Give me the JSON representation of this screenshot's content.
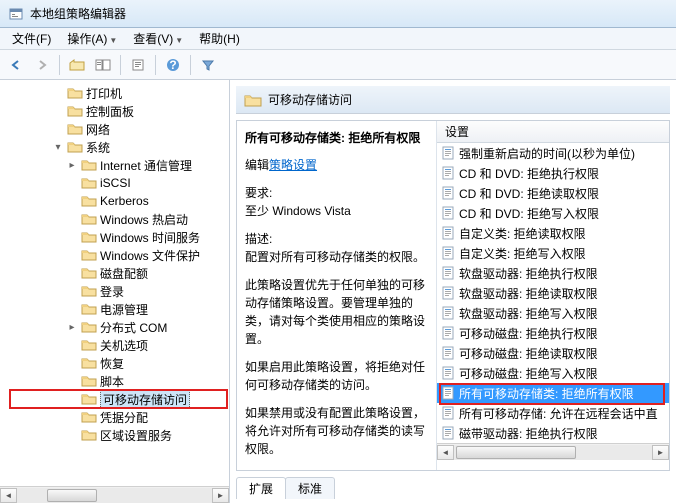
{
  "window": {
    "title": "本地组策略编辑器"
  },
  "menu": {
    "file": "文件(F)",
    "action": "操作(A)",
    "view": "查看(V)",
    "help": "帮助(H)"
  },
  "tree": [
    {
      "d": 3,
      "t": "",
      "l": "打印机"
    },
    {
      "d": 3,
      "t": "",
      "l": "控制面板"
    },
    {
      "d": 3,
      "t": "",
      "l": "网络"
    },
    {
      "d": 3,
      "t": "▾",
      "l": "系统"
    },
    {
      "d": 4,
      "t": "▸",
      "l": "Internet 通信管理"
    },
    {
      "d": 4,
      "t": "",
      "l": "iSCSI"
    },
    {
      "d": 4,
      "t": "",
      "l": "Kerberos"
    },
    {
      "d": 4,
      "t": "",
      "l": "Windows 热启动"
    },
    {
      "d": 4,
      "t": "",
      "l": "Windows 时间服务"
    },
    {
      "d": 4,
      "t": "",
      "l": "Windows 文件保护"
    },
    {
      "d": 4,
      "t": "",
      "l": "磁盘配额"
    },
    {
      "d": 4,
      "t": "",
      "l": "登录"
    },
    {
      "d": 4,
      "t": "",
      "l": "电源管理"
    },
    {
      "d": 4,
      "t": "▸",
      "l": "分布式 COM"
    },
    {
      "d": 4,
      "t": "",
      "l": "关机选项"
    },
    {
      "d": 4,
      "t": "",
      "l": "恢复"
    },
    {
      "d": 4,
      "t": "",
      "l": "脚本"
    },
    {
      "d": 4,
      "t": "",
      "l": "可移动存储访问",
      "sel": true,
      "hl": true
    },
    {
      "d": 4,
      "t": "",
      "l": "凭据分配"
    },
    {
      "d": 4,
      "t": "",
      "l": "区域设置服务"
    }
  ],
  "header": {
    "title": "可移动存储访问"
  },
  "desc": {
    "title": "所有可移动存储类: 拒绝所有权限",
    "editLabel": "编辑",
    "editLink": "策略设置",
    "reqLabel": "要求:",
    "req": "至少 Windows Vista",
    "descLabel": "描述:",
    "p1": "配置对所有可移动存储类的权限。",
    "p2": "此策略设置优先于任何单独的可移动存储策略设置。要管理单独的类，请对每个类使用相应的策略设置。",
    "p3": "如果启用此策略设置，将拒绝对任何可移动存储类的访问。",
    "p4": "如果禁用或没有配置此策略设置，将允许对所有可移动存储类的读写权限。"
  },
  "listHeader": "设置",
  "items": [
    "强制重新启动的时间(以秒为单位)",
    "CD 和 DVD: 拒绝执行权限",
    "CD 和 DVD: 拒绝读取权限",
    "CD 和 DVD: 拒绝写入权限",
    "自定义类: 拒绝读取权限",
    "自定义类: 拒绝写入权限",
    "软盘驱动器: 拒绝执行权限",
    "软盘驱动器: 拒绝读取权限",
    "软盘驱动器: 拒绝写入权限",
    "可移动磁盘: 拒绝执行权限",
    "可移动磁盘: 拒绝读取权限",
    "可移动磁盘: 拒绝写入权限",
    "所有可移动存储类: 拒绝所有权限",
    "所有可移动存储: 允许在远程会话中直",
    "磁带驱动器: 拒绝执行权限"
  ],
  "selIndex": 12,
  "tabs": {
    "ext": "扩展",
    "std": "标准"
  }
}
